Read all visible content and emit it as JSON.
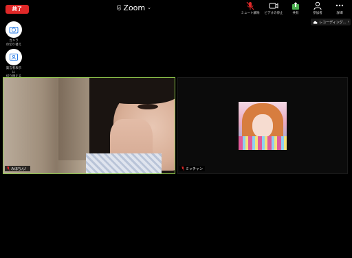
{
  "header": {
    "end_label": "終了",
    "app_title": "Zoom",
    "toolbar": [
      {
        "id": "mute",
        "label": "ミュート解除",
        "icon": "mic-muted-icon"
      },
      {
        "id": "video",
        "label": "ビデオの停止",
        "icon": "video-camera-icon"
      },
      {
        "id": "share",
        "label": "共有",
        "icon": "share-upload-icon"
      },
      {
        "id": "participants",
        "label": "参加者",
        "icon": "participants-icon"
      },
      {
        "id": "more",
        "label": "詳細",
        "icon": "more-dots-icon"
      }
    ]
  },
  "recording": {
    "label": "レコーディング…",
    "icon": "cloud-icon"
  },
  "side_controls": [
    {
      "id": "switch-camera",
      "label": "カメラ\nの切り替え",
      "icon": "camera-switch-icon"
    },
    {
      "id": "switch-view",
      "label": "発言者表示\nに\n切り替える",
      "icon": "speaker-view-icon"
    }
  ],
  "participants": [
    {
      "name": "みほちん！",
      "muted": true,
      "active_speaker": true
    },
    {
      "name": "ミッチャン",
      "muted": true,
      "active_speaker": false
    }
  ],
  "colors": {
    "end_button": "#e02828",
    "active_border": "#8bc34a",
    "muted_red": "#e02828",
    "share_green": "#4caf50"
  }
}
